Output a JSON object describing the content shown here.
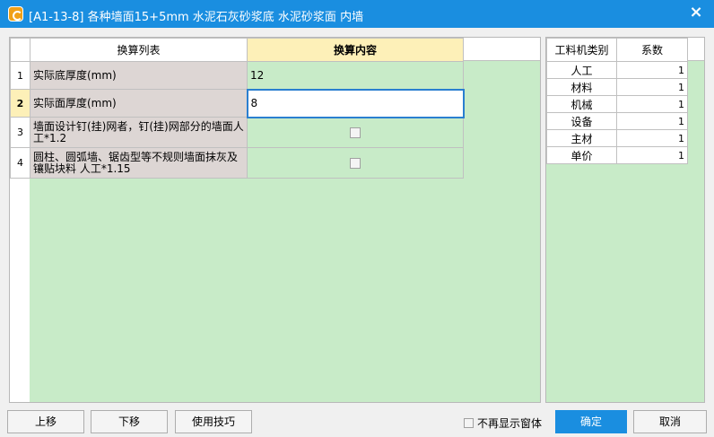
{
  "window": {
    "title": "[A1-13-8] 各种墙面15+5mm 水泥石灰砂浆底 水泥砂浆面 内墙",
    "close_icon": "×"
  },
  "conversion_table": {
    "headers": [
      "换算列表",
      "换算内容"
    ],
    "rows": [
      {
        "num": "1",
        "name": "实际底厚度(mm)",
        "value": "12"
      },
      {
        "num": "2",
        "name": "实际面厚度(mm)",
        "value": "8"
      },
      {
        "num": "3",
        "name": "墙面设计钉(挂)网者，钉(挂)网部分的墙面人工*1.2",
        "checked": false
      },
      {
        "num": "4",
        "name": "圆柱、圆弧墙、锯齿型等不规则墙面抹灰及镶贴块料 人工*1.15",
        "checked": false
      }
    ]
  },
  "coefficient_table": {
    "headers": [
      "工料机类别",
      "系数"
    ],
    "rows": [
      {
        "category": "人工",
        "value": "1"
      },
      {
        "category": "材料",
        "value": "1"
      },
      {
        "category": "机械",
        "value": "1"
      },
      {
        "category": "设备",
        "value": "1"
      },
      {
        "category": "主材",
        "value": "1"
      },
      {
        "category": "单价",
        "value": "1"
      }
    ]
  },
  "footer": {
    "move_up": "上移",
    "move_down": "下移",
    "tips": "使用技巧",
    "no_show": "不再显示窗体",
    "ok": "确定",
    "cancel": "取消"
  },
  "colors": {
    "titlebar": "#1a8ee0",
    "grid_bg": "#c8ebc8",
    "header_active": "#fdf0b8",
    "name_cell": "#ddd6d4"
  }
}
